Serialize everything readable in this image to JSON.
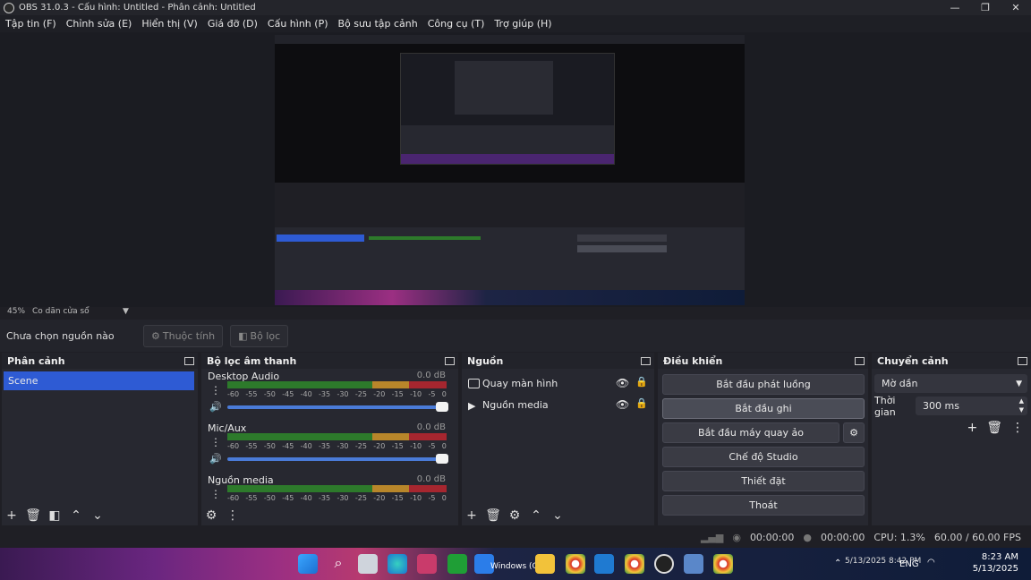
{
  "window": {
    "title": "OBS 31.0.3 - Cấu hình: Untitled - Phân cảnh: Untitled",
    "controls": {
      "min": "—",
      "max": "❐",
      "close": "✕"
    }
  },
  "menu": [
    "Tập tin (F)",
    "Chỉnh sửa (E)",
    "Hiển thị (V)",
    "Giá đỡ (D)",
    "Cấu hình (P)",
    "Bộ sưu tập cảnh",
    "Công cụ (T)",
    "Trợ giúp (H)"
  ],
  "zoom": {
    "level": "45%",
    "mode": "Co dãn cửa sổ"
  },
  "source_bar": {
    "label": "Chưa chọn nguồn nào",
    "properties": "Thuộc tính",
    "filters": "Bộ lọc"
  },
  "scenes": {
    "title": "Phân cảnh",
    "items": [
      "Scene"
    ]
  },
  "mixer": {
    "title": "Bộ lọc âm thanh",
    "channels": [
      {
        "name": "Desktop Audio",
        "db": "0.0 dB"
      },
      {
        "name": "Mic/Aux",
        "db": "0.0 dB"
      },
      {
        "name": "Nguồn media",
        "db": "0.0 dB"
      }
    ],
    "ticks": [
      "-60",
      "-55",
      "-50",
      "-45",
      "-40",
      "-35",
      "-30",
      "-25",
      "-20",
      "-15",
      "-10",
      "-5",
      "0"
    ]
  },
  "sources": {
    "title": "Nguồn",
    "items": [
      {
        "name": "Quay màn hình",
        "icon": "monitor-icon"
      },
      {
        "name": "Nguồn media",
        "icon": "play-icon"
      }
    ]
  },
  "controls": {
    "title": "Điều khiển",
    "start_stream": "Bắt đầu phát luồng",
    "start_record": "Bắt đầu ghi",
    "virtual_cam": "Bắt đầu máy quay ảo",
    "studio": "Chế độ Studio",
    "settings": "Thiết đặt",
    "exit": "Thoát"
  },
  "transitions": {
    "title": "Chuyển cảnh",
    "type": "Mờ dần",
    "duration_label": "Thời gian",
    "duration": "300 ms"
  },
  "status": {
    "time1": "00:00:00",
    "time2": "00:00:00",
    "cpu": "CPU: 1.3%",
    "fps": "60.00 / 60.00 FPS"
  },
  "taskbar": {
    "lang": "ENG",
    "time": "8:23 AM",
    "date": "5/13/2025",
    "overlay_text": "5/13/2025 8:42 PM",
    "app_label": "Windows (C:)"
  },
  "colors": {
    "accent": "#2e5bd4",
    "meter_green": "#2d7a2b",
    "meter_yellow": "#b8862a",
    "meter_red": "#a6262f"
  }
}
